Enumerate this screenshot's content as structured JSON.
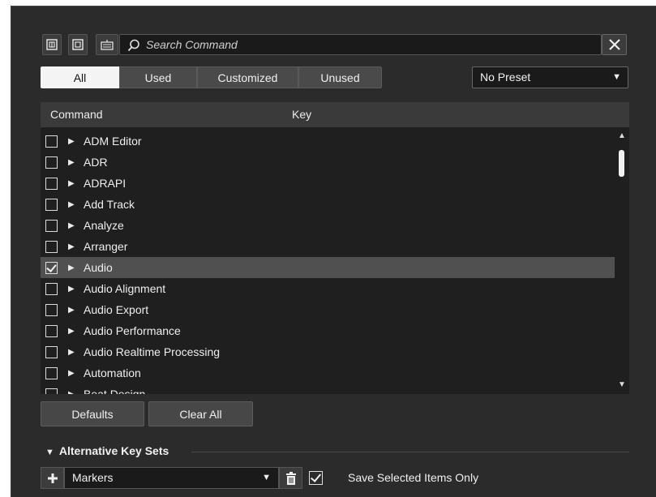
{
  "toolbar": {
    "expand_icon": "expand-all-icon",
    "collapse_icon": "collapse-all-icon",
    "keyboard_icon": "keyboard-icon",
    "search_placeholder": "Search Command",
    "close_icon": "close-icon"
  },
  "filters": [
    {
      "label": "All",
      "active": true
    },
    {
      "label": "Used",
      "active": false
    },
    {
      "label": "Customized",
      "active": false
    },
    {
      "label": "Unused",
      "active": false
    }
  ],
  "preset": {
    "value": "No Preset"
  },
  "list": {
    "headers": {
      "command": "Command",
      "key": "Key"
    },
    "rows": [
      {
        "label": "ADM Editor",
        "checked": false,
        "selected": false
      },
      {
        "label": "ADR",
        "checked": false,
        "selected": false
      },
      {
        "label": "ADRAPI",
        "checked": false,
        "selected": false
      },
      {
        "label": "Add Track",
        "checked": false,
        "selected": false
      },
      {
        "label": "Analyze",
        "checked": false,
        "selected": false
      },
      {
        "label": "Arranger",
        "checked": false,
        "selected": false
      },
      {
        "label": "Audio",
        "checked": true,
        "selected": true
      },
      {
        "label": "Audio Alignment",
        "checked": false,
        "selected": false
      },
      {
        "label": "Audio Export",
        "checked": false,
        "selected": false
      },
      {
        "label": "Audio Performance",
        "checked": false,
        "selected": false
      },
      {
        "label": "Audio Realtime Processing",
        "checked": false,
        "selected": false
      },
      {
        "label": "Automation",
        "checked": false,
        "selected": false
      },
      {
        "label": "Beat Design",
        "checked": false,
        "selected": false
      }
    ]
  },
  "buttons": {
    "defaults": "Defaults",
    "clear_all": "Clear All"
  },
  "alt_key_sets": {
    "title": "Alternative Key Sets",
    "selected": "Markers",
    "save_selected_label": "Save Selected Items Only",
    "save_selected_checked": true
  },
  "colors": {
    "panel": "#2b2b2b",
    "list_bg": "#1f1f1f",
    "selected_row": "#505050",
    "active_tab": "#f4f4f4"
  }
}
